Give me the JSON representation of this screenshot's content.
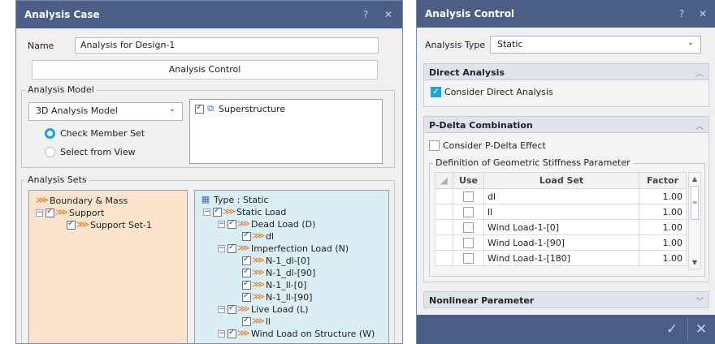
{
  "analysis_case": {
    "title": "Analysis Case",
    "help": "?",
    "close": "✕",
    "name_label": "Name",
    "name_value": "Analysis for Design-1",
    "analysis_control_button": "Analysis Control",
    "analysis_model": {
      "group_title": "Analysis Model",
      "model_select": "3D Analysis Model",
      "radio_check_member": "Check Member Set",
      "radio_select_view": "Select from View",
      "structure_item": "Superstructure"
    },
    "analysis_sets": {
      "group_title": "Analysis Sets",
      "boundary_tree": [
        "Boundary & Mass",
        "Support",
        "Support Set-1"
      ],
      "load_tree": [
        "Type : Static",
        "Static Load",
        "Dead Load (D)",
        "dl",
        "Imperfection Load (N)",
        "N-1_dl-[0]",
        "N-1_dl-[90]",
        "N-1_ll-[0]",
        "N-1_ll-[90]",
        "Live Load (L)",
        "ll",
        "Wind Load on Structure (W)"
      ]
    }
  },
  "analysis_control": {
    "title": "Analysis Control",
    "help": "?",
    "close": "✕",
    "analysis_type_label": "Analysis Type",
    "analysis_type_value": "Static",
    "direct_analysis": {
      "header": "Direct Analysis",
      "consider_label": "Consider Direct Analysis",
      "consider_checked": true
    },
    "pdelta": {
      "header": "P-Delta Combination",
      "consider_label": "Consider P-Delta Effect",
      "consider_checked": false,
      "group_title": "Definition of Geometric Stiffness Parameter",
      "columns": [
        "Use",
        "Load Set",
        "Factor"
      ],
      "rows": [
        {
          "use": false,
          "load_set": "dl",
          "factor": "1.00"
        },
        {
          "use": false,
          "load_set": "ll",
          "factor": "1.00"
        },
        {
          "use": false,
          "load_set": "Wind Load-1-[0]",
          "factor": "1.00"
        },
        {
          "use": false,
          "load_set": "Wind Load-1-[90]",
          "factor": "1.00"
        },
        {
          "use": false,
          "load_set": "Wind Load-1-[180]",
          "factor": "1.00"
        }
      ]
    },
    "nonlinear": {
      "header": "Nonlinear Parameter"
    },
    "ok_icon": "✓",
    "cancel_icon": "✕"
  },
  "colors": {
    "titlebar": "#4a5e86",
    "accent": "#1ea0d8",
    "boundary_panel": "#fbe3cd",
    "load_panel": "#dbeef4"
  }
}
